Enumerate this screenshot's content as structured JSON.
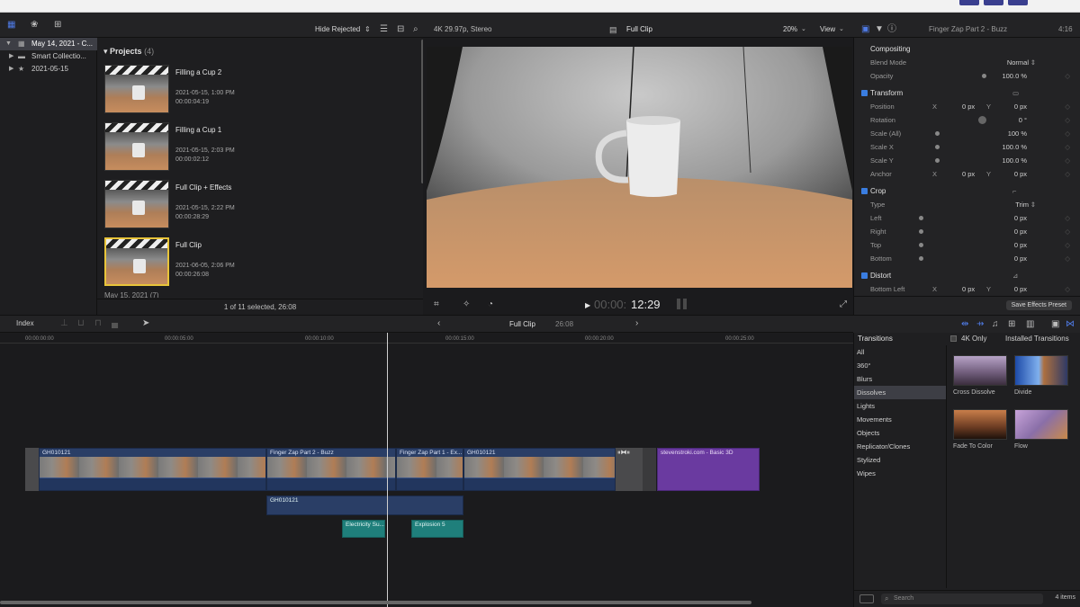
{
  "toolbar": {
    "hide_rejected": "Hide Rejected",
    "format": "4K 29.97p, Stereo",
    "clip_name": "Full Clip",
    "zoom": "20%",
    "view": "View",
    "inspector_title": "Finger Zap Part 2 - Buzz",
    "inspector_time": "4:16"
  },
  "library": {
    "items": [
      {
        "label": "May 14, 2021 - C..."
      },
      {
        "label": "Smart Collectio..."
      },
      {
        "label": "2021-05-15"
      }
    ]
  },
  "browser": {
    "header": "Projects",
    "count": "(4)",
    "projects": [
      {
        "name": "Filling a Cup 2",
        "date": "2021-05-15, 1:00 PM",
        "duration": "00:00:04:19"
      },
      {
        "name": "Filling a Cup 1",
        "date": "2021-05-15, 2:03 PM",
        "duration": "00:00:02:12"
      },
      {
        "name": "Full Clip + Effects",
        "date": "2021-05-15, 2:22 PM",
        "duration": "00:00:28:29"
      },
      {
        "name": "Full Clip",
        "date": "2021-06-05, 2:06 PM",
        "duration": "00:00:26:08"
      }
    ],
    "next_section": "May 15, 2021 (7)",
    "status": "1 of 11 selected, 26:08"
  },
  "viewer": {
    "timecode_dim": "00:00:",
    "timecode": "12:29"
  },
  "inspector": {
    "compositing": "Compositing",
    "blend_mode_label": "Blend Mode",
    "blend_mode": "Normal",
    "opacity_label": "Opacity",
    "opacity": "100.0 %",
    "transform": "Transform",
    "position_label": "Position",
    "position_x": "0 px",
    "position_y": "0 px",
    "rotation_label": "Rotation",
    "rotation": "0 °",
    "scale_all_label": "Scale (All)",
    "scale_all": "100 %",
    "scale_x_label": "Scale X",
    "scale_x": "100.0 %",
    "scale_y_label": "Scale Y",
    "scale_y": "100.0 %",
    "anchor_label": "Anchor",
    "anchor_x": "0 px",
    "anchor_y": "0 px",
    "crop": "Crop",
    "type_label": "Type",
    "type": "Trim",
    "left_label": "Left",
    "left": "0 px",
    "right_label": "Right",
    "right": "0 px",
    "top_label": "Top",
    "top": "0 px",
    "bottom_label": "Bottom",
    "bottom": "0 px",
    "distort": "Distort",
    "bottom_left_label": "Bottom Left",
    "bottom_left_x": "0 px",
    "bottom_left_y": "0 px",
    "save_preset": "Save Effects Preset",
    "x": "X",
    "y": "Y"
  },
  "timeline_bar": {
    "index": "Index",
    "project": "Full Clip",
    "duration": "26:08"
  },
  "ruler": [
    "00:00:00:00",
    "00:00:05:00",
    "00:00:10:00",
    "00:00:15:00",
    "00:00:20:00",
    "00:00:25:00"
  ],
  "clips": {
    "c1": "GH010121",
    "c2": "Finger Zap Part 2 - Buzz",
    "c3": "Finger Zap Part 1 - Ex...",
    "c4": "GH010121",
    "title": "stevenstroki.com - Basic 3D",
    "connected": "GH010121",
    "audio1": "Electricity Su...",
    "audio2": "Explosion 5"
  },
  "transitions": {
    "title": "Transitions",
    "four_k": "4K Only",
    "installed": "Installed Transitions",
    "categories": [
      "All",
      "360°",
      "Blurs",
      "Dissolves",
      "Lights",
      "Movements",
      "Objects",
      "Replicator/Clones",
      "Stylized",
      "Wipes"
    ],
    "items": [
      "Cross Dissolve",
      "Divide",
      "Fade To Color",
      "Flow"
    ],
    "search": "Search",
    "count": "4 items"
  }
}
